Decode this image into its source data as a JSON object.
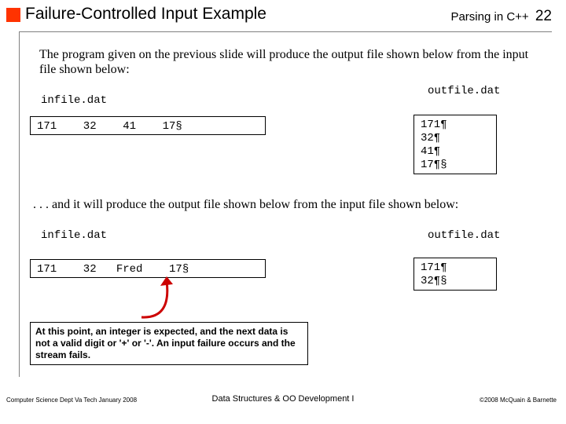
{
  "header": {
    "title": "Failure-Controlled Input Example",
    "course": "Parsing in C++",
    "slide_num": "22"
  },
  "intro": "The program given on the previous slide will produce the output file shown below from  the input file shown below:",
  "labels": {
    "infile": "infile.dat",
    "outfile": "outfile.dat"
  },
  "files": {
    "in1": "171    32    41    17§",
    "out1": "171¶\n32¶\n41¶\n17¶§",
    "in2": "171    32   Fred    17§",
    "out2": "171¶\n32¶§"
  },
  "midline": ".  .  . and it will produce the output file shown below from  the input file shown below:",
  "note": "At this point, an integer is expected, and the next data is not a valid digit or '+' or '-'.  An input failure occurs and the stream fails.",
  "footer": {
    "left": "Computer Science Dept Va Tech January 2008",
    "center": "Data Structures & OO Development I",
    "right": "©2008 McQuain & Barnette"
  }
}
